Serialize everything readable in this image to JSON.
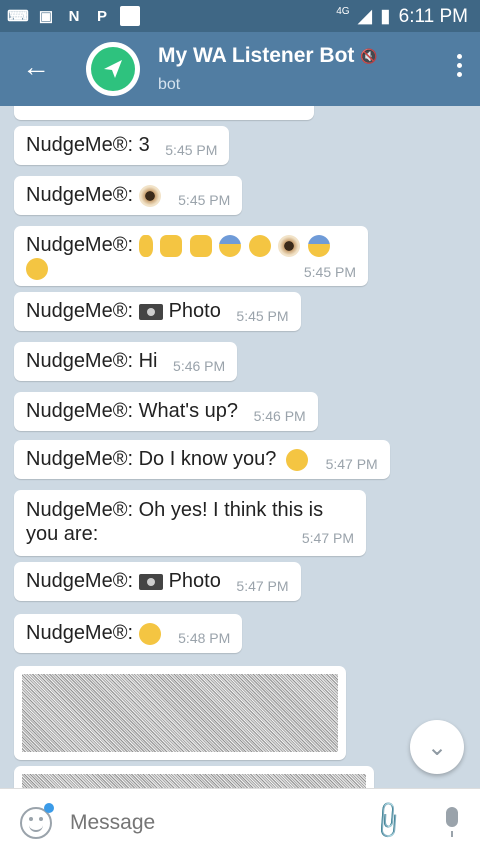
{
  "status": {
    "network": "4G",
    "time": "6:11 PM",
    "apps": [
      "N",
      "P"
    ]
  },
  "header": {
    "title": "My WA Listener Bot",
    "subtitle": "bot"
  },
  "messages": [
    {
      "sender": "NudgeMe®:",
      "text": "3",
      "time": "5:45 PM"
    },
    {
      "sender": "NudgeMe®:",
      "text": "",
      "time": "5:45 PM"
    },
    {
      "sender": "NudgeMe®:",
      "text": "",
      "time": "5:45 PM"
    },
    {
      "sender": "NudgeMe®:",
      "text": "Photo",
      "time": "5:45 PM"
    },
    {
      "sender": "NudgeMe®:",
      "text": "Hi",
      "time": "5:46 PM"
    },
    {
      "sender": "NudgeMe®:",
      "text": "What's up?",
      "time": "5:46 PM"
    },
    {
      "sender": "NudgeMe®:",
      "text": "Do I know you?",
      "time": "5:47 PM"
    },
    {
      "sender": "NudgeMe®:",
      "text": "Oh yes! I think this is you are:",
      "time": "5:47 PM"
    },
    {
      "sender": "NudgeMe®:",
      "text": "Photo",
      "time": "5:47 PM"
    },
    {
      "sender": "NudgeMe®:",
      "text": "",
      "time": "5:48 PM"
    }
  ],
  "input": {
    "placeholder": "Message"
  },
  "colors": {
    "header": "#517da2",
    "statusbar": "#3f6785",
    "bubble": "#ffffff"
  }
}
